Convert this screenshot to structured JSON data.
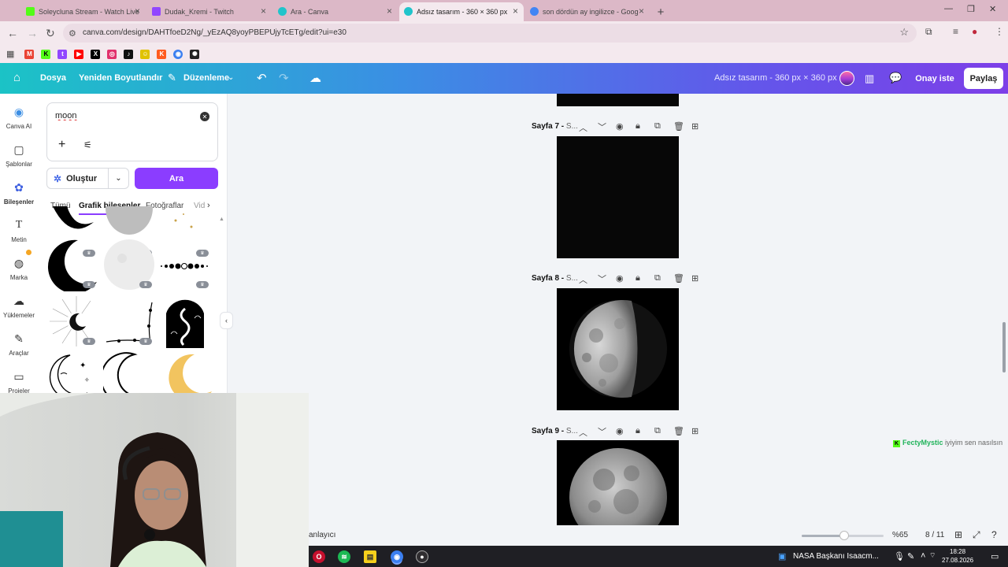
{
  "browser": {
    "tabs": [
      {
        "label": "Soleycluna Stream - Watch Live",
        "favicon_color": "#53fc18",
        "active": false
      },
      {
        "label": "Dudak_Kremi - Twitch",
        "favicon_color": "#9146ff",
        "active": false
      },
      {
        "label": "Ara - Canva",
        "favicon_color": "#20c4cb",
        "active": false
      },
      {
        "label": "Adsız tasarım - 360 × 360 px",
        "favicon_color": "#20c4cb",
        "active": true
      },
      {
        "label": "son dördün ay ingilizce - Goog",
        "favicon_color": "#4285f4",
        "active": false
      }
    ],
    "url": "canva.com/design/DAHTfoeD2Ng/_yEzAQ8yoyPBEPUjyTcETg/edit?ui=e30",
    "bookmarks": [
      {
        "name": "gmail",
        "color": "#ea4335",
        "glyph": "M"
      },
      {
        "name": "kick",
        "color": "#53fc18",
        "glyph": "K"
      },
      {
        "name": "twitch",
        "color": "#9146ff",
        "glyph": "t"
      },
      {
        "name": "youtube",
        "color": "#ff0000",
        "glyph": "▶"
      },
      {
        "name": "x",
        "color": "#000000",
        "glyph": "X"
      },
      {
        "name": "instagram",
        "color": "#e1306c",
        "glyph": "◎"
      },
      {
        "name": "tiktok",
        "color": "#111111",
        "glyph": "♪"
      },
      {
        "name": "snapchat",
        "color": "#e0c200",
        "glyph": "☺"
      },
      {
        "name": "kick-alt",
        "color": "#ff5a1f",
        "glyph": "K"
      },
      {
        "name": "chrome",
        "color": "#3b7ff0",
        "glyph": "◉"
      },
      {
        "name": "chatgpt",
        "color": "#222222",
        "glyph": "✺"
      }
    ]
  },
  "header": {
    "file": "Dosya",
    "resize": "Yeniden Boyutlandır",
    "edit": "Düzenleme",
    "doc_title": "Adsız tasarım - 360 px × 360 px",
    "approve": "Onay iste",
    "share": "Paylaş"
  },
  "rail": [
    {
      "label": "Canva AI",
      "icon": "canva-ai-icon",
      "glyph": "◉"
    },
    {
      "label": "Şablonlar",
      "icon": "templates-icon",
      "glyph": "▢"
    },
    {
      "label": "Bileşenler",
      "icon": "elements-icon",
      "glyph": "✿",
      "active": true
    },
    {
      "label": "Metin",
      "icon": "text-icon",
      "glyph": "T"
    },
    {
      "label": "Marka",
      "icon": "brand-icon",
      "glyph": "◍"
    },
    {
      "label": "Yüklemeler",
      "icon": "uploads-icon",
      "glyph": "☁"
    },
    {
      "label": "Araçlar",
      "icon": "tools-icon",
      "glyph": "✎"
    },
    {
      "label": "Projeler",
      "icon": "projects-icon",
      "glyph": "▭"
    }
  ],
  "panel": {
    "search_value": "moon",
    "create_label": "Oluştur",
    "search_button": "Ara",
    "tabs": [
      "Tümü",
      "Grafik bileşenler",
      "Fotoğraflar",
      "Vid"
    ],
    "active_tab": "Grafik bileşenler"
  },
  "pages": [
    {
      "label": "Sayfa 7 -",
      "suffix": "S...",
      "content": "black"
    },
    {
      "label": "Sayfa 8 -",
      "suffix": "S...",
      "content": "half-moon"
    },
    {
      "label": "Sayfa 9 -",
      "suffix": "S...",
      "content": "full-moon"
    }
  ],
  "bottom": {
    "notes": "anlayıcı",
    "zoom": "%65",
    "zoom_level": 0.52,
    "page_count": "8 / 11"
  },
  "overlay": {
    "name": "FectyMystic",
    "text": "iyiyim sen nasılsın"
  },
  "taskbar": {
    "news": "NASA Başkanı Isaacm...",
    "time": "18:28",
    "date": "27.08.2026"
  }
}
